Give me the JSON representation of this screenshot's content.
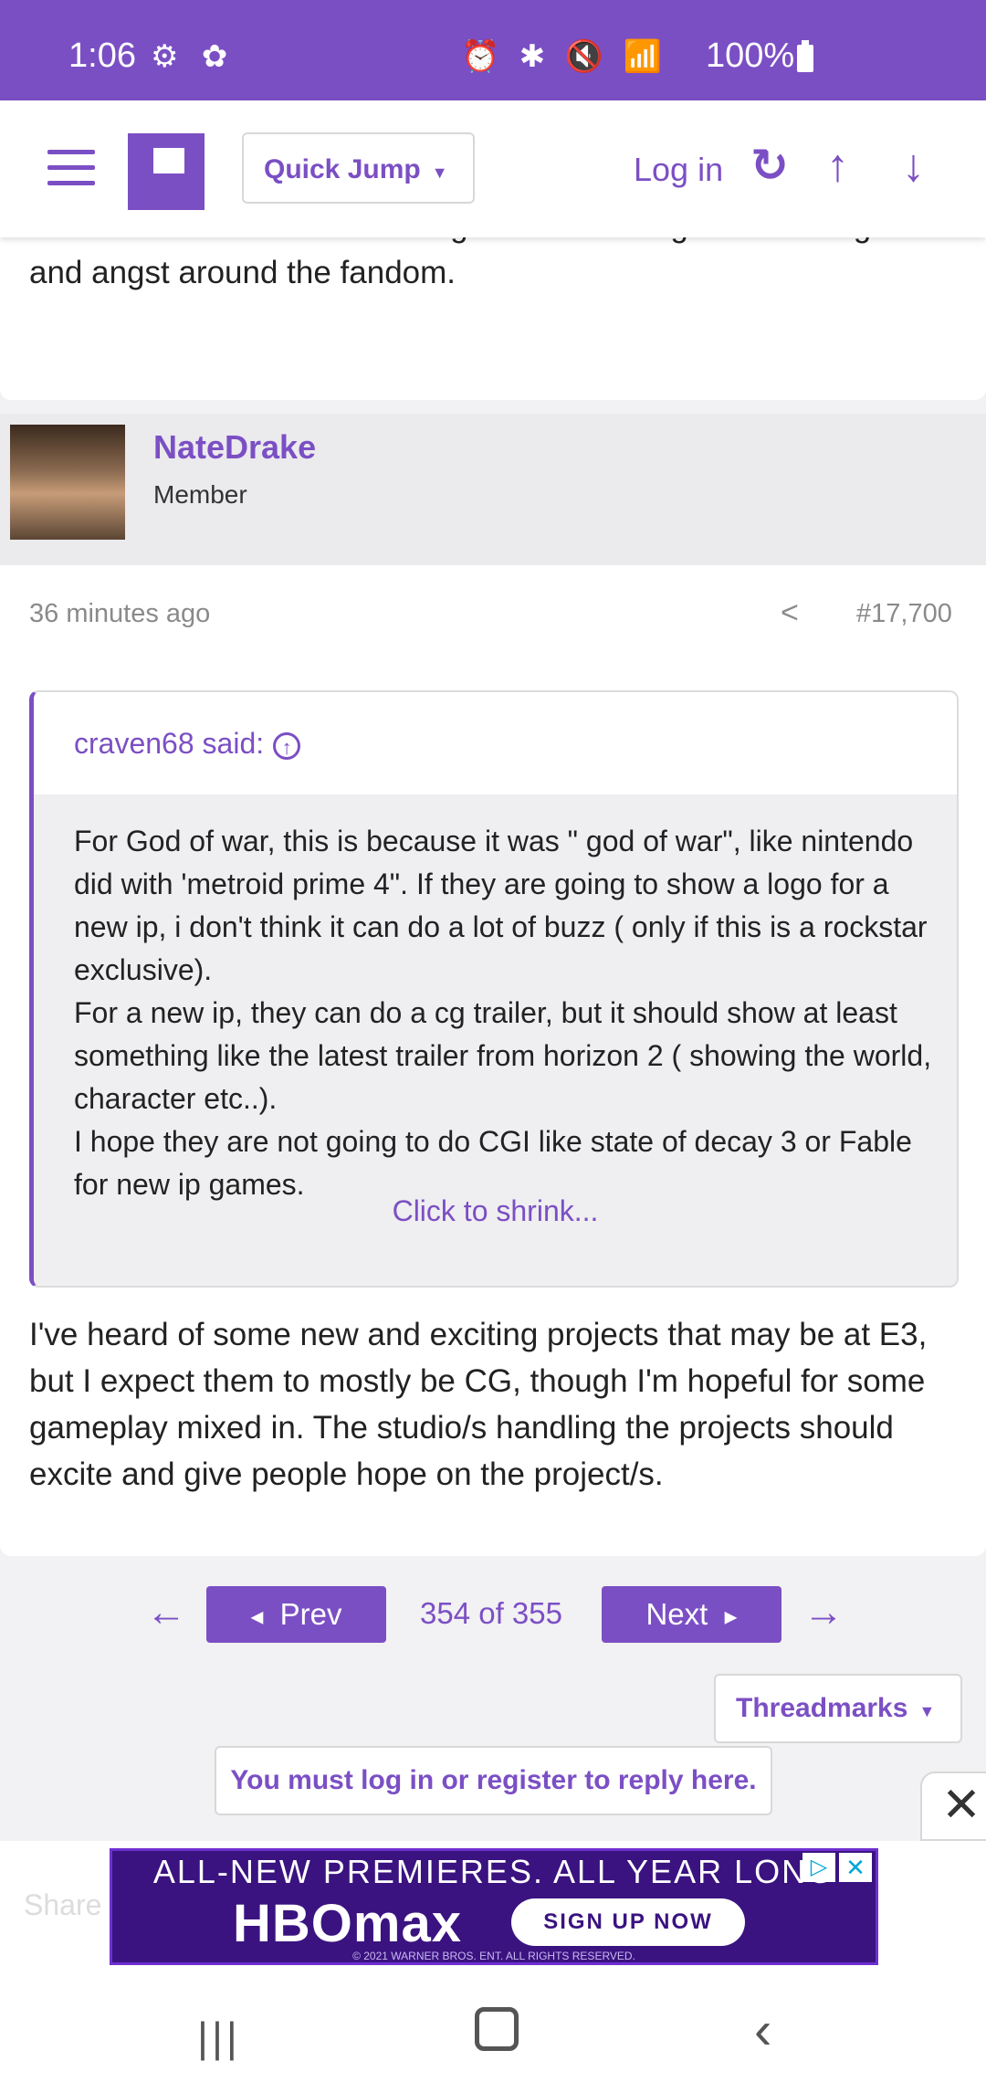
{
  "status_bar": {
    "time": "1:06",
    "left_icons": "⚙ ✿",
    "right_icons": "⏰ ✱ 🔇 📶",
    "battery": "100%"
  },
  "nav": {
    "quick_jump": "Quick Jump",
    "login": "Log in",
    "icons": [
      "menu-icon",
      "logo-icon",
      "refresh-icon",
      "arrow-up-icon",
      "arrow-down-icon"
    ]
  },
  "previous_post": {
    "text": "themselves and shows about games. I never get all the anger and angst around the fandom."
  },
  "post": {
    "author": "NateDrake",
    "author_title": "Member",
    "time": "36 minutes ago",
    "number": "#17,700",
    "quote": {
      "author": "craven68 said:",
      "paragraphs": [
        "For God of war, this is because it was \" god of war\", like nintendo did with 'metroid prime 4\". If they are going to show a logo for a new ip, i don't think it can do a lot of buzz ( only if this is a rockstar exclusive).",
        "For a new ip, they can do a cg trailer, but it should show at least something like the latest trailer from horizon 2 ( showing the world, character etc..).",
        "I hope they are not going to do CGI like state of decay 3 or Fable for new ip games."
      ],
      "shrink": "Click to shrink..."
    },
    "body": "I've heard of some new and exciting projects that may be at E3, but I expect them to mostly be CG, though I'm hopeful for some gameplay mixed in. The studio/s handling the projects should excite and give people hope on the project/s."
  },
  "pagination": {
    "prev": "Prev",
    "next": "Next",
    "info": "354 of 355"
  },
  "threadmarks": "Threadmarks",
  "login_reply": "You must log in or register to reply here.",
  "share_label": "Share",
  "ad": {
    "headline": "ALL-NEW PREMIERES. ALL YEAR LONG",
    "brand": "HBOmax",
    "cta": "SIGN UP NOW",
    "legal": "© 2021 WARNER BROS. ENT. ALL RIGHTS RESERVED."
  },
  "colors": {
    "accent": "#7b4fc4",
    "ad_bg": "#3a1380"
  }
}
